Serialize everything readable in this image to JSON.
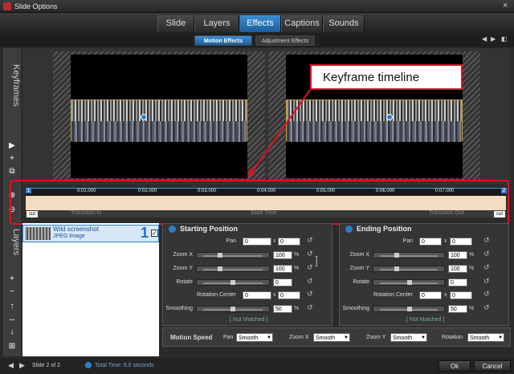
{
  "window": {
    "title": "Slide Options",
    "close_icon": "×"
  },
  "tabs": [
    {
      "label": "Slide"
    },
    {
      "label": "Layers"
    },
    {
      "label": "Effects",
      "active": true
    },
    {
      "label": "Captions"
    },
    {
      "label": "Sounds"
    }
  ],
  "subtabs": [
    {
      "label": "Motion Effects",
      "active": true
    },
    {
      "label": "Adjustment Effects"
    }
  ],
  "sidebar": {
    "keyframes_label": "Keyframes",
    "layers_label": "Layers"
  },
  "callout": {
    "text": "Keyframe timeline"
  },
  "timeline": {
    "ticks": [
      "0:01.000",
      "0:02.000",
      "0:03.000",
      "0:04.000",
      "0:05.000",
      "0:06.000",
      "0:07.000"
    ],
    "start_marker": "1",
    "end_marker": "2",
    "transition_in": "Transition In",
    "slide_time": "Slide Time",
    "transition_out": "Transition Out",
    "cut_left": "cut",
    "cut_right": "cut"
  },
  "layer": {
    "name": "Wild screenshot",
    "type": "JPEG Image",
    "number": "1",
    "checked": "✓"
  },
  "start": {
    "title": "Starting Position",
    "pan_label": "Pan",
    "pan_x": "0",
    "pan_y": "0",
    "zoomx_label": "Zoom X",
    "zoomx": "100",
    "zoomy_label": "Zoom Y",
    "zoomy": "100",
    "rotate_label": "Rotate",
    "rotate": "0",
    "rc_label": "Rotation Center",
    "rc_x": "0",
    "rc_y": "0",
    "smooth_label": "Smoothing",
    "smooth": "50",
    "not_matched": "[ Not Matched ]",
    "pct": "%",
    "x": "x"
  },
  "end": {
    "title": "Ending Position",
    "pan_label": "Pan",
    "pan_x": "0",
    "pan_y": "0",
    "zoomx_label": "Zoom X",
    "zoomx": "100",
    "zoomy_label": "Zoom Y",
    "zoomy": "100",
    "rotate_label": "Rotate",
    "rotate": "0",
    "rc_label": "Rotation Center",
    "rc_x": "0",
    "rc_y": "0",
    "smooth_label": "Smoothing",
    "smooth": "50",
    "not_matched": "[ Not Matched ]",
    "pct": "%",
    "x": "x"
  },
  "motion": {
    "title": "Motion Speed",
    "pan_label": "Pan",
    "pan": "Smooth",
    "zoomx_label": "Zoom X",
    "zoomx": "Smooth",
    "zoomy_label": "Zoom Y",
    "zoomy": "Smooth",
    "rotation_label": "Rotation",
    "rotation": "Smooth"
  },
  "status": {
    "slide": "Slide 2 of 2",
    "total_time": "Total Time: 6.0 seconds",
    "ok": "Ok",
    "cancel": "Cancel"
  },
  "colors": {
    "accent": "#2a80d0",
    "callout_border": "#d12",
    "timeline_track": "#f2dcc2"
  }
}
